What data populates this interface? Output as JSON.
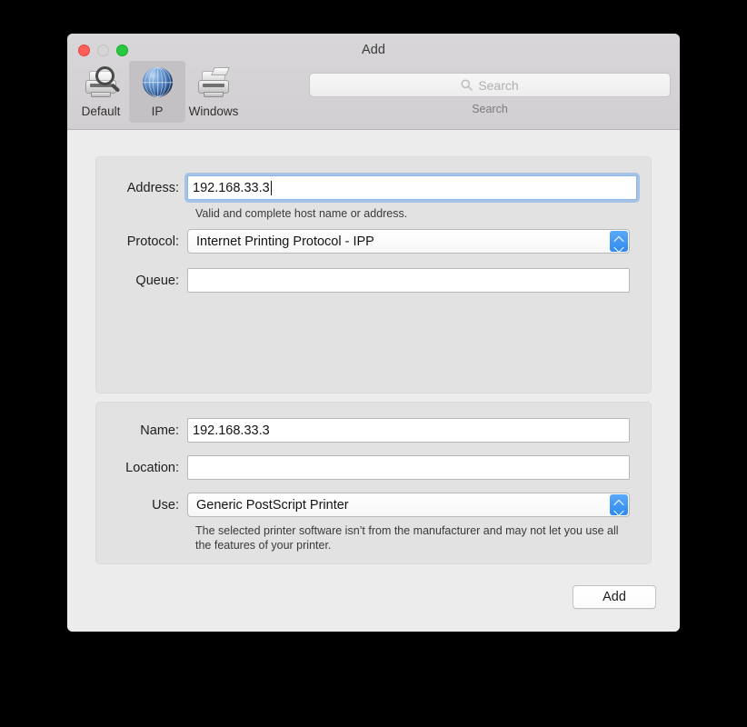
{
  "window": {
    "title": "Add",
    "traffic_lights": [
      {
        "name": "close",
        "color": "#ff5f57"
      },
      {
        "name": "minimize",
        "color": "#d5d5d5"
      },
      {
        "name": "zoom",
        "color": "#28c940"
      }
    ]
  },
  "toolbar": {
    "tabs": [
      {
        "id": "default",
        "label": "Default",
        "icon": "printer-magnifier-icon",
        "selected": false
      },
      {
        "id": "ip",
        "label": "IP",
        "icon": "globe-icon",
        "selected": true
      },
      {
        "id": "windows",
        "label": "Windows",
        "icon": "printer-windows-icon",
        "selected": false
      }
    ],
    "search": {
      "icon": "search-icon",
      "placeholder": "Search",
      "value": "",
      "caption": "Search"
    }
  },
  "form": {
    "address": {
      "label": "Address:",
      "value": "192.168.33.3",
      "hint": "Valid and complete host name or address.",
      "focused": true
    },
    "protocol": {
      "label": "Protocol:",
      "value": "Internet Printing Protocol - IPP"
    },
    "queue": {
      "label": "Queue:",
      "value": "",
      "placeholder": ""
    },
    "name": {
      "label": "Name:",
      "value": "192.168.33.3"
    },
    "location": {
      "label": "Location:",
      "value": ""
    },
    "use": {
      "label": "Use:",
      "value": "Generic PostScript Printer",
      "hint": "The selected printer software isn’t from the manufacturer and may not let you use all the features of your printer."
    }
  },
  "footer": {
    "add_label": "Add"
  },
  "colors": {
    "accent": "#2e8bf0",
    "toolbar_bg": "#d4d2d4",
    "content_bg": "#ececec",
    "panel_bg": "#e3e2e3",
    "focus_ring": "#76aae6"
  }
}
